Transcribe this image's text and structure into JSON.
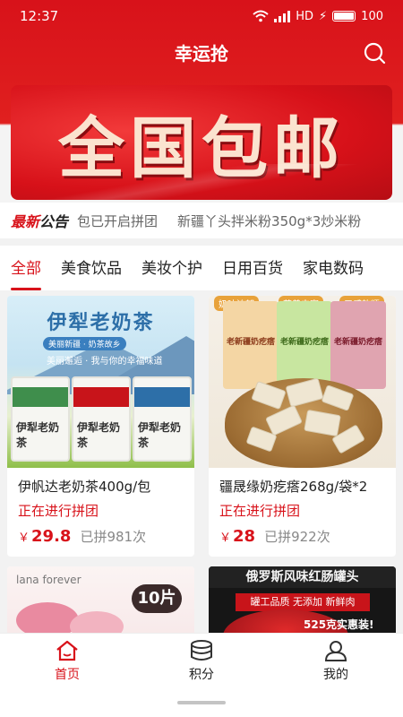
{
  "status_bar": {
    "time": "12:37",
    "battery": "100",
    "network": "HD",
    "signal_icon": "signal-icon",
    "wifi_icon": "wifi-icon"
  },
  "header": {
    "title": "幸运抢",
    "search_icon": "search-icon"
  },
  "banner": {
    "text": "全国包邮"
  },
  "notice": {
    "badge_red": "最新",
    "badge_black": "公告",
    "items": [
      "包已开启拼团",
      "新疆丫头拌米粉350g*3炒米粉"
    ]
  },
  "tabs": [
    {
      "label": "全部",
      "active": true
    },
    {
      "label": "美食饮品",
      "active": false
    },
    {
      "label": "美妆个护",
      "active": false
    },
    {
      "label": "日用百货",
      "active": false
    },
    {
      "label": "家电数码",
      "active": false
    }
  ],
  "products": [
    {
      "name": "伊帆达老奶茶400g/包",
      "status": "正在进行拼团",
      "currency": "￥",
      "price": "29.8",
      "sold": "已拼981次",
      "image": {
        "title": "伊犁老奶茶",
        "banner_line1": "美丽新疆 · 奶茶故乡",
        "banner_line2": "美丽邂逅 · 我与你的幸福味道",
        "pack_label": "伊犁老奶茶"
      }
    },
    {
      "name": "疆晟缘奶疙瘩268g/袋*2",
      "status": "正在进行拼团",
      "currency": "￥",
      "price": "28",
      "sold": "已拼922次",
      "image": {
        "tags": [
          "奶味浓郁",
          "营养丰富",
          "口感软糯"
        ],
        "bag_label": "老新疆奶疙瘩"
      }
    },
    {
      "name": "",
      "image": {
        "badge": "10片",
        "logo": "lana forever"
      }
    },
    {
      "name": "",
      "image": {
        "headline": "俄罗斯风味红肠罐头",
        "sub": "罐工品质 无添加 新鲜肉",
        "tag": "525克实惠装!"
      }
    }
  ],
  "bottom_nav": [
    {
      "label": "首页",
      "icon": "home-icon",
      "active": true
    },
    {
      "label": "积分",
      "icon": "coins-icon",
      "active": false
    },
    {
      "label": "我的",
      "icon": "user-icon",
      "active": false
    }
  ],
  "colors": {
    "primary": "#d8121a",
    "text": "#222222",
    "muted": "#888888"
  }
}
